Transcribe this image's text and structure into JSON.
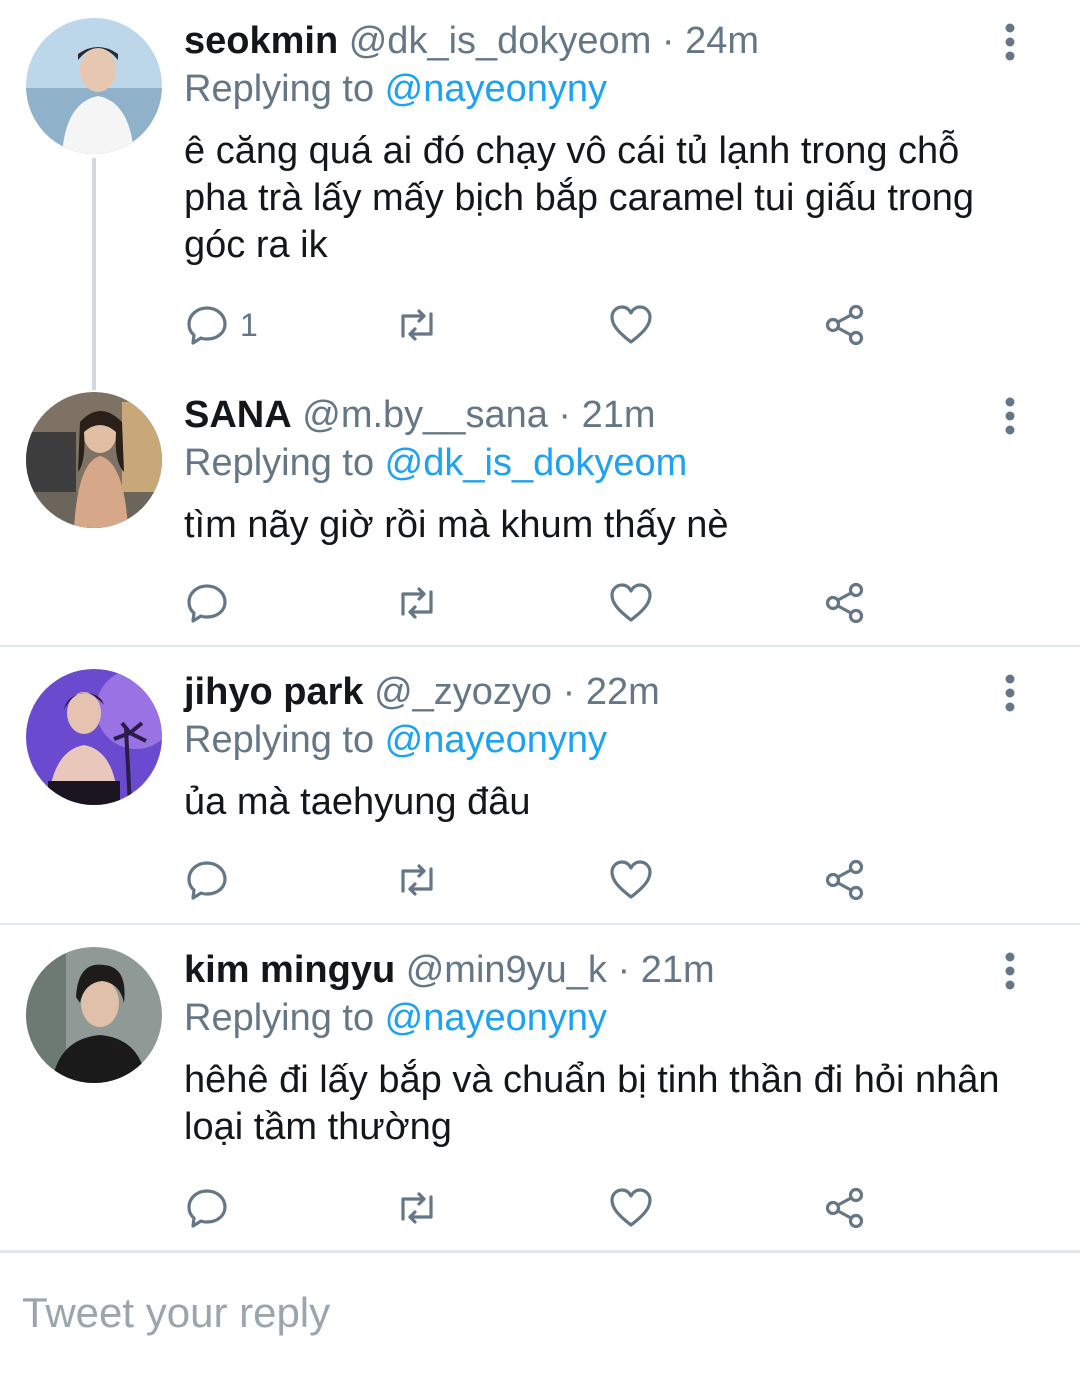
{
  "tweets": [
    {
      "name": "seokmin",
      "handle": "@dk_is_dokyeom",
      "sep": "·",
      "time": "24m",
      "replying_prefix": "Replying to ",
      "replying_to": "@nayeonyny",
      "text": "ê căng quá ai đó chạy vô cái tủ lạnh trong chỗ pha trà lấy mấy bịch bắp caramel tui giấu trong góc ra ik",
      "reply_count": "1",
      "avatar_colors": [
        "#a9c9e3",
        "#f2f2f2"
      ]
    },
    {
      "name": "SANA",
      "handle": "@m.by__sana",
      "sep": "·",
      "time": "21m",
      "replying_prefix": "Replying to ",
      "replying_to": "@dk_is_dokyeom",
      "text": "tìm nãy giờ rồi mà khum thấy nè",
      "reply_count": "",
      "avatar_colors": [
        "#8a7a66",
        "#d8b89a"
      ]
    },
    {
      "name": "jihyo park",
      "handle": "@_zyozyo",
      "sep": "·",
      "time": "22m",
      "replying_prefix": "Replying to ",
      "replying_to": "@nayeonyny",
      "text": "ủa mà taehyung đâu",
      "reply_count": "",
      "avatar_colors": [
        "#7a55d8",
        "#e6bfe8"
      ]
    },
    {
      "name": "kim mingyu",
      "handle": "@min9yu_k",
      "sep": "·",
      "time": "21m",
      "replying_prefix": "Replying to ",
      "replying_to": "@nayeonyny",
      "text": "hêhê đi lấy bắp và chuẩn bị tinh thần đi hỏi nhân loại tầm thường",
      "reply_count": "",
      "avatar_colors": [
        "#7f8a86",
        "#1e1e1e"
      ]
    }
  ],
  "icons": {
    "reply": "reply-icon",
    "retweet": "retweet-icon",
    "like": "heart-icon",
    "share": "share-icon",
    "more": "more-vertical-icon"
  },
  "colors": {
    "text": "#14171a",
    "muted": "#657786",
    "mention": "#1da1f2",
    "divider": "#e1e8ed"
  },
  "composer": {
    "placeholder": "Tweet your reply"
  }
}
